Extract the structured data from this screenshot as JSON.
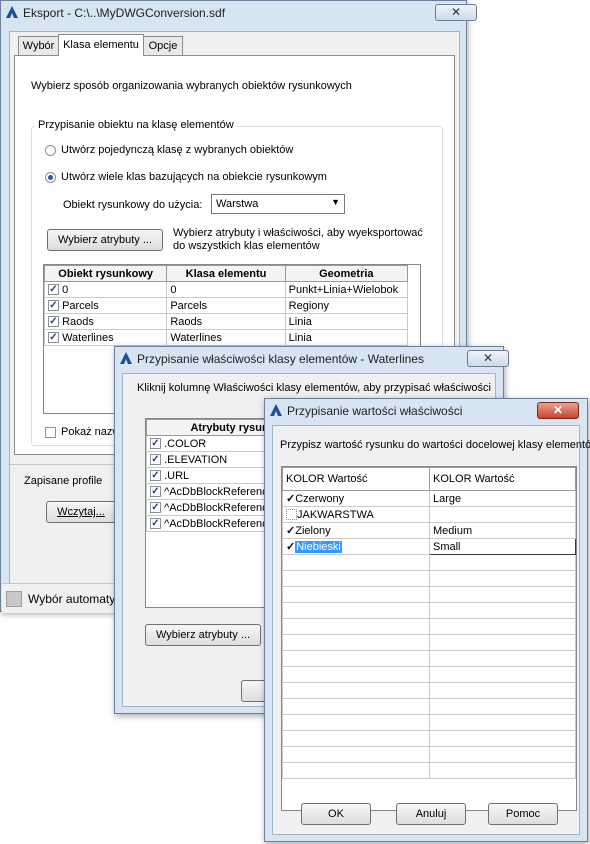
{
  "main": {
    "title": "Eksport - C:\\..\\MyDWGConversion.sdf",
    "tabs": [
      "Wybór",
      "Klasa elementu",
      "Opcje"
    ],
    "instruction": "Wybierz sposób organizowania wybranych obiektów rysunkowych",
    "group_title": "Przypisanie obiektu na klasę elementów",
    "radio_single": "Utwórz pojedynczą klasę z wybranych obiektów",
    "radio_multiple": "Utwórz wiele klas bazujących na obiekcie rysunkowym",
    "object_label": "Obiekt rysunkowy do użycia:",
    "object_value": "Warstwa",
    "choose_attributes": "Wybierz atrybuty ...",
    "choose_attributes_hint": "Wybierz atrybuty i właściwości, aby wyeksportować do wszystkich klas elementów",
    "columns": [
      "Obiekt rysunkowy",
      "Klasa elementu",
      "Geometria"
    ],
    "rows": [
      {
        "object": "0",
        "class": "0",
        "geometry": "Punkt+Linia+Wielobok"
      },
      {
        "object": "Parcels",
        "class": "Parcels",
        "geometry": "Regiony"
      },
      {
        "object": "Raods",
        "class": "Raods",
        "geometry": "Linia"
      },
      {
        "object": "Waterlines",
        "class": "Waterlines",
        "geometry": "Linia"
      }
    ],
    "show_names": "Pokaż nazw",
    "saved_profiles": "Zapisane profile",
    "load_button": "Wczytaj...",
    "status": "Wybór automaty"
  },
  "props": {
    "title": "Przypisanie właściwości klasy elementów - Waterlines",
    "instruction": "Kliknij kolumnę Właściwości klasy elementów, aby przypisać właściwości",
    "column": "Atrybuty rysunku",
    "rows": [
      ".COLOR",
      ".ELEVATION",
      ".URL",
      "^AcDbBlockReference",
      "^AcDbBlockReference",
      "^AcDbBlockReference"
    ],
    "choose_attributes": "Wybierz atrybuty ..."
  },
  "values": {
    "title": "Przypisanie wartości właściwości",
    "instruction": "Przypisz wartość rysunku do wartości docelowej klasy elementów",
    "col1": "KOLOR Wartość",
    "col2": "KOLOR Wartość",
    "rows": [
      {
        "checked": true,
        "source": "Czerwony",
        "target": "Large"
      },
      {
        "checked": false,
        "source": "JAKWARSTWA",
        "target": ""
      },
      {
        "checked": true,
        "source": "Zielony",
        "target": "Medium"
      },
      {
        "checked": true,
        "source": "Niebieski",
        "target": "Small"
      }
    ],
    "ok": "OK",
    "cancel": "Anuluj",
    "help": "Pomoc"
  }
}
